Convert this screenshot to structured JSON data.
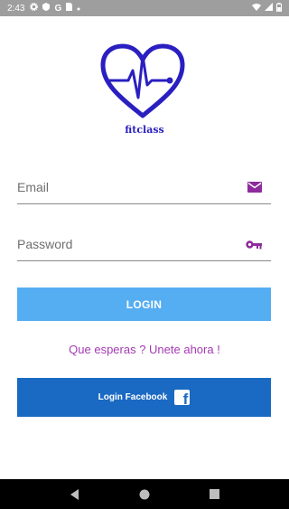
{
  "status_bar": {
    "time": "2:43",
    "icons": [
      "gear-icon",
      "shield-icon",
      "google-icon",
      "sim-icon",
      "dot-icon"
    ],
    "right_icons": [
      "wifi-icon",
      "signal-icon",
      "battery-icon"
    ]
  },
  "app": {
    "brand_name": "fitclass",
    "logo": "heart-pulse-icon"
  },
  "form": {
    "email_label": "Email",
    "email_icon": "mail-icon",
    "password_label": "Password",
    "password_icon": "key-icon",
    "login_label": "LOGIN",
    "signup_text": "Que esperas ? Unete ahora !",
    "facebook_label": "Login Facebook",
    "facebook_icon": "facebook-icon"
  },
  "colors": {
    "accent_purple": "#a33ab2",
    "login_button": "#55adf2",
    "facebook_button": "#1a69c2",
    "logo_blue": "#2a1fc0"
  },
  "nav_bar": {
    "buttons": [
      "back-icon",
      "home-icon",
      "recents-icon"
    ]
  }
}
